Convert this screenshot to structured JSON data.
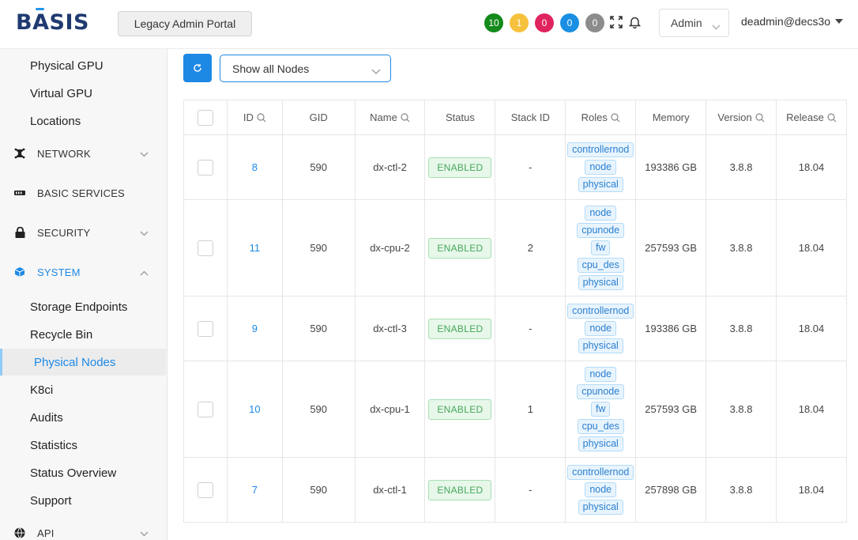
{
  "header": {
    "logo_text": "BASIS",
    "legacy_button": "Legacy Admin Portal",
    "badges": [
      {
        "count": "10",
        "color": "#148a1c"
      },
      {
        "count": "1",
        "color": "#f6c23e"
      },
      {
        "count": "0",
        "color": "#e0245e"
      },
      {
        "count": "0",
        "color": "#1a8fe3"
      },
      {
        "count": "0",
        "color": "#8c8c8c"
      }
    ],
    "role_select": "Admin",
    "user": "deadmin@decs3o"
  },
  "sidebar": {
    "top_items": [
      "Physical GPU",
      "Virtual GPU",
      "Locations"
    ],
    "sections": [
      {
        "label": "NETWORK",
        "icon": "network-icon",
        "expanded": false
      },
      {
        "label": "BASIC SERVICES",
        "icon": "basic-services-icon",
        "expanded": false
      },
      {
        "label": "SECURITY",
        "icon": "lock-icon",
        "expanded": false
      },
      {
        "label": "SYSTEM",
        "icon": "cube-icon",
        "expanded": true
      }
    ],
    "system_items": [
      "Storage Endpoints",
      "Recycle Bin",
      "Physical Nodes",
      "K8ci",
      "Audits",
      "Statistics",
      "Status Overview",
      "Support"
    ],
    "active_item": "Physical Nodes",
    "api_section": {
      "label": "API",
      "icon": "globe-icon"
    }
  },
  "toolbar": {
    "filter_value": "Show all Nodes"
  },
  "table": {
    "columns": [
      "ID",
      "GID",
      "Name",
      "Status",
      "Stack ID",
      "Roles",
      "Memory",
      "Version",
      "Release"
    ],
    "searchable_columns": [
      "ID",
      "Name",
      "Roles",
      "Version",
      "Release"
    ],
    "rows": [
      {
        "id": "8",
        "gid": "590",
        "name": "dx-ctl-2",
        "status": "ENABLED",
        "stack_id": "-",
        "roles": [
          "controllernod",
          "node",
          "physical"
        ],
        "memory": "193386 GB",
        "version": "3.8.8",
        "release": "18.04"
      },
      {
        "id": "11",
        "gid": "590",
        "name": "dx-cpu-2",
        "status": "ENABLED",
        "stack_id": "2",
        "roles": [
          "node",
          "cpunode",
          "fw",
          "cpu_des",
          "physical"
        ],
        "memory": "257593 GB",
        "version": "3.8.8",
        "release": "18.04"
      },
      {
        "id": "9",
        "gid": "590",
        "name": "dx-ctl-3",
        "status": "ENABLED",
        "stack_id": "-",
        "roles": [
          "controllernod",
          "node",
          "physical"
        ],
        "memory": "193386 GB",
        "version": "3.8.8",
        "release": "18.04"
      },
      {
        "id": "10",
        "gid": "590",
        "name": "dx-cpu-1",
        "status": "ENABLED",
        "stack_id": "1",
        "roles": [
          "node",
          "cpunode",
          "fw",
          "cpu_des",
          "physical"
        ],
        "memory": "257593 GB",
        "version": "3.8.8",
        "release": "18.04"
      },
      {
        "id": "7",
        "gid": "590",
        "name": "dx-ctl-1",
        "status": "ENABLED",
        "stack_id": "-",
        "roles": [
          "controllernod",
          "node",
          "physical"
        ],
        "memory": "257898 GB",
        "version": "3.8.8",
        "release": "18.04"
      }
    ]
  }
}
